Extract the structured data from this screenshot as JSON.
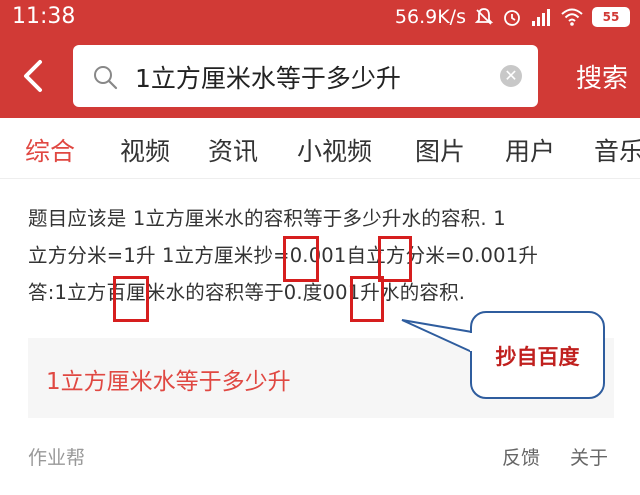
{
  "status_bar": {
    "time": "11:38",
    "net_speed": "56.9K/s",
    "battery": "55"
  },
  "search": {
    "query": "1立方厘米水等于多少升",
    "search_button": "搜索"
  },
  "tabs": [
    "综合",
    "视频",
    "资讯",
    "小视频",
    "图片",
    "用户",
    "音乐"
  ],
  "result": {
    "line1": "题目应该是 1立方厘米水的容积等于多少升水的容积. 1",
    "line2": "立方分米=1升 1立方厘米抄=0.001自立方分米=0.001升",
    "line3": "答:1立方百厘米水的容积等于0.度001升水的容积."
  },
  "related": {
    "text": "1立方厘米水等于多少升"
  },
  "callout": {
    "text": "抄自百度",
    "border_color": "#2f5d9e",
    "text_color": "#c0201e"
  },
  "footer": {
    "source": "作业帮",
    "feedback": "反馈",
    "about": "关于"
  },
  "colors": {
    "brand_red": "#d13a36",
    "tab_active": "#e04842",
    "highlight": "#d61e1e"
  }
}
